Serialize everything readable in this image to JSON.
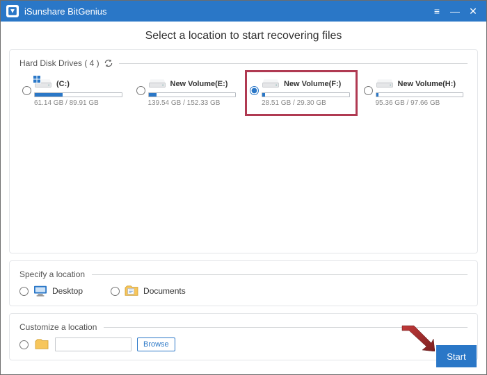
{
  "app": {
    "title": "iSunshare BitGenius"
  },
  "page": {
    "title": "Select a location to start recovering files"
  },
  "sections": {
    "drives_label": "Hard Disk Drives ( 4 )",
    "specify_label": "Specify a location",
    "custom_label": "Customize a location"
  },
  "drives": [
    {
      "name": "(C:)",
      "size": "61.14 GB / 89.91 GB",
      "fill_pct": 32,
      "selected": false,
      "os_badge": true
    },
    {
      "name": "New Volume(E:)",
      "size": "139.54 GB / 152.33 GB",
      "fill_pct": 9,
      "selected": false,
      "os_badge": false
    },
    {
      "name": "New Volume(F:)",
      "size": "28.51 GB / 29.30 GB",
      "fill_pct": 3,
      "selected": true,
      "os_badge": false
    },
    {
      "name": "New Volume(H:)",
      "size": "95.36 GB / 97.66 GB",
      "fill_pct": 3,
      "selected": false,
      "os_badge": false
    }
  ],
  "locations": {
    "desktop": "Desktop",
    "documents": "Documents"
  },
  "buttons": {
    "browse": "Browse",
    "start": "Start"
  },
  "highlighted_drive_index": 2
}
